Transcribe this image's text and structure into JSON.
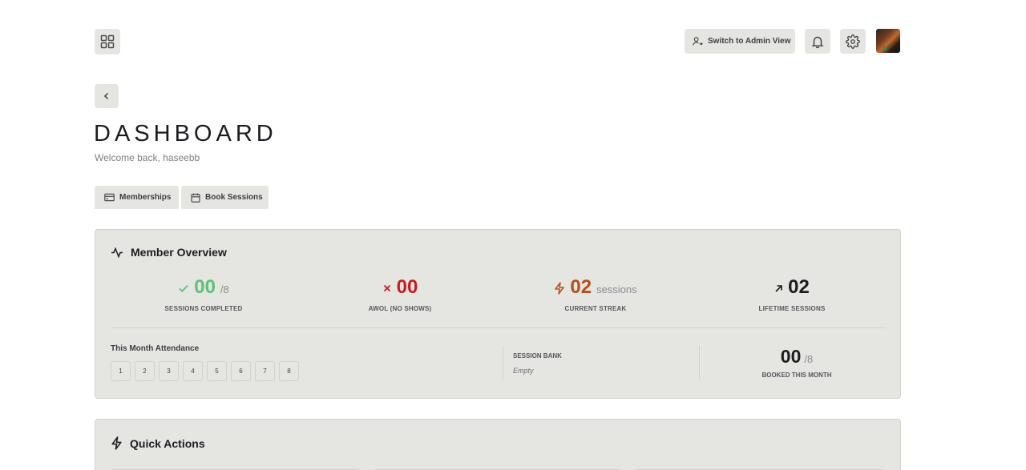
{
  "header": {
    "admin_button_label": "Switch to Admin View",
    "icons": [
      "grid-icon",
      "user-switch-icon",
      "bell-icon",
      "gear-icon",
      "avatar"
    ]
  },
  "page": {
    "title": "DASHBOARD",
    "welcome": "Welcome back, haseebb"
  },
  "tabs": [
    {
      "label": "Memberships",
      "icon": "credit-card-icon"
    },
    {
      "label": "Book Sessions",
      "icon": "calendar-icon"
    }
  ],
  "overview": {
    "title": "Member Overview",
    "stats": {
      "completed": {
        "value": "00",
        "suffix": "/8",
        "caption": "SESSIONS COMPLETED",
        "color": "#5cc27a"
      },
      "awol": {
        "value": "00",
        "caption": "AWOL (NO SHOWS)",
        "color": "#c81e1e"
      },
      "streak": {
        "value": "02",
        "suffix": "sessions",
        "caption": "CURRENT STREAK",
        "color": "#b3501c"
      },
      "lifetime": {
        "value": "02",
        "caption": "LIFETIME SESSIONS",
        "color": "#1c1d20"
      }
    },
    "attendance": {
      "label": "This Month Attendance",
      "days": [
        "1",
        "2",
        "3",
        "4",
        "5",
        "6",
        "7",
        "8"
      ]
    },
    "session_bank": {
      "label": "SESSION BANK",
      "value": "Empty"
    },
    "booked": {
      "value": "00",
      "suffix": "/8",
      "caption": "BOOKED THIS MONTH"
    }
  },
  "quick_actions": {
    "title": "Quick Actions"
  }
}
